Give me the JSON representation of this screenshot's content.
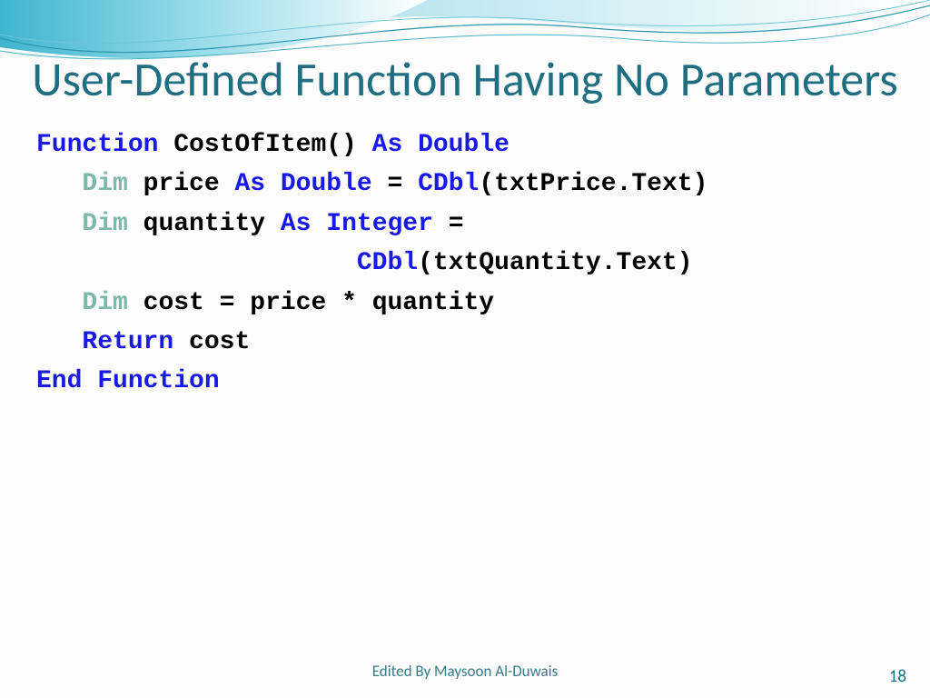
{
  "title": "User-Defined Function Having No Parameters",
  "code": {
    "l1_fn": "Function",
    "l1_name": " CostOfItem() ",
    "l1_as": "As Double",
    "indent": "   ",
    "dim": "Dim",
    "l2_body": " price ",
    "l2_as": "As Double",
    "l2_eq": " = ",
    "l2_cdbl": "CDbl",
    "l2_arg": "(txtPrice.Text)",
    "l3_body": " quantity ",
    "l3_as": "As Integer",
    "l3_eq": " = ",
    "cont_indent": "                     ",
    "l4_cdbl": "CDbl",
    "l4_arg": "(txtQuantity.Text)",
    "l5_body": " cost = price * quantity",
    "ret": "Return",
    "ret_body": " cost",
    "end": "End Function"
  },
  "footer": "Edited By Maysoon Al-Duwais",
  "page": "18"
}
